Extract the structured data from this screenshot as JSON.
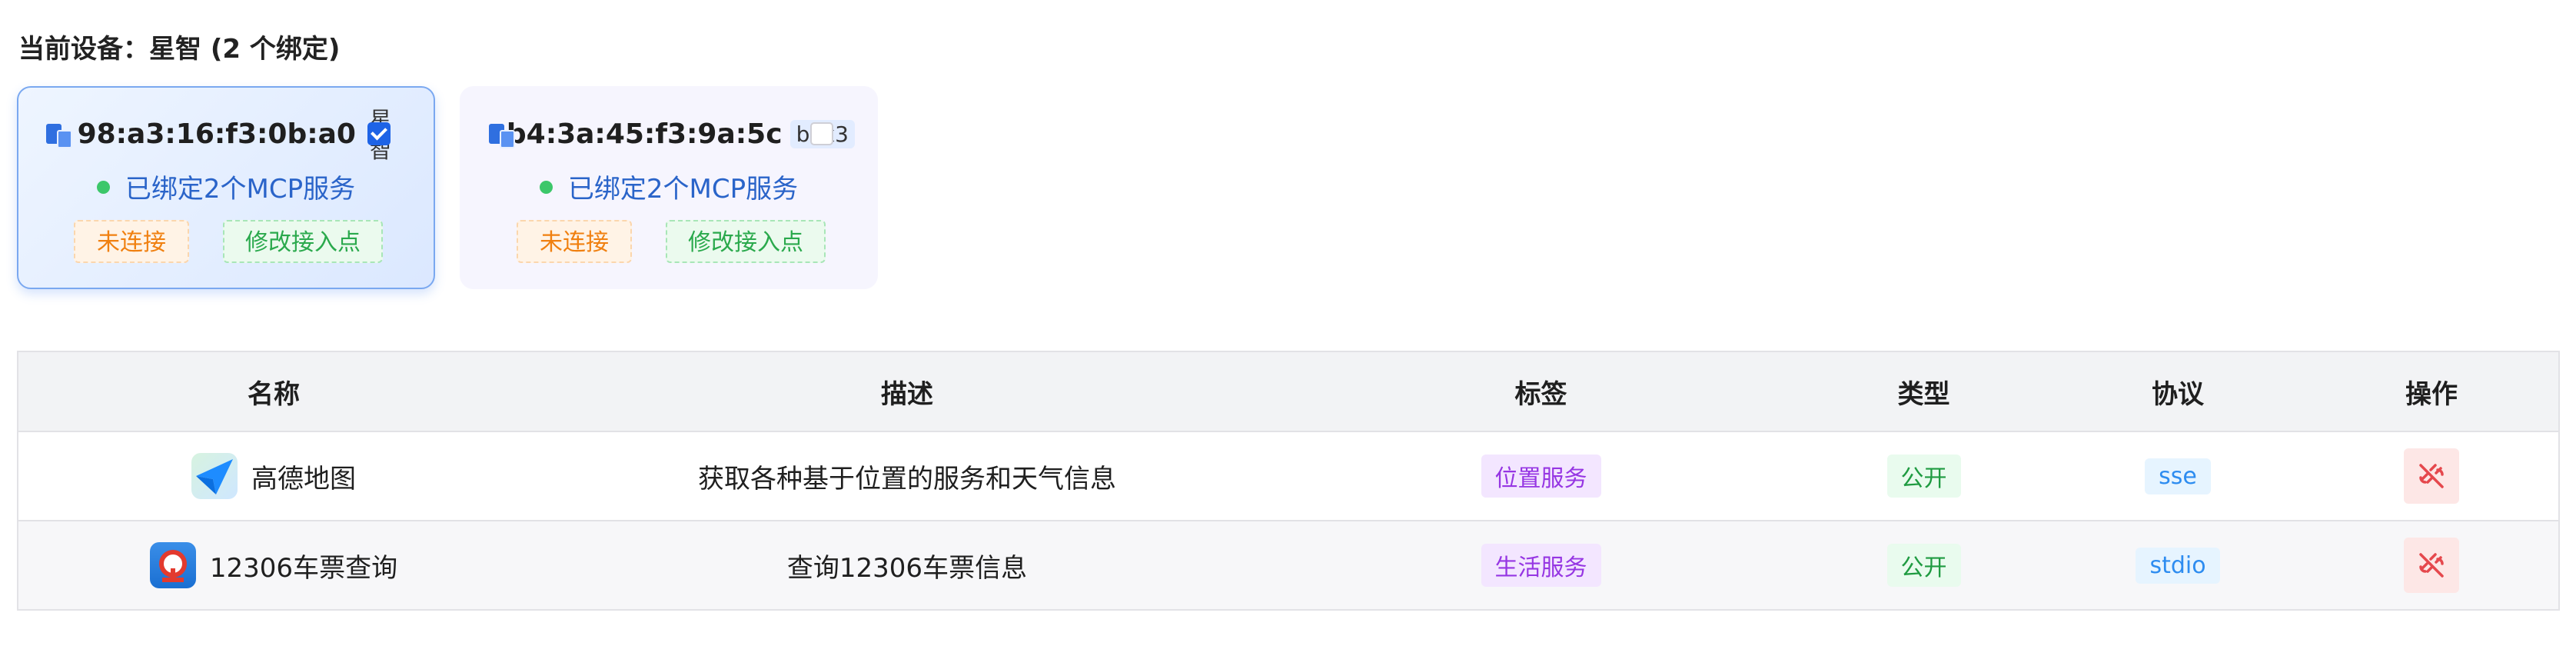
{
  "header": {
    "current_device": "当前设备：星智 (2 个绑定)"
  },
  "devices": [
    {
      "mac": "98:a3:16:f3:0b:a0",
      "alias": "星智",
      "checked": true,
      "bound_text": "已绑定2个MCP服务",
      "status": "未连接",
      "edit_label": "修改接入点"
    },
    {
      "mac": "b4:3a:45:f3:9a:5c",
      "alias": "box3",
      "checked": false,
      "bound_text": "已绑定2个MCP服务",
      "status": "未连接",
      "edit_label": "修改接入点"
    }
  ],
  "table": {
    "headers": [
      "名称",
      "描述",
      "标签",
      "类型",
      "协议",
      "操作"
    ],
    "rows": [
      {
        "name": "高德地图",
        "icon": "amap-icon",
        "description": "获取各种基于位置的服务和天气信息",
        "tag": "位置服务",
        "type": "公开",
        "protocol": "sse",
        "action_icon": "unlink-icon"
      },
      {
        "name": "12306车票查询",
        "icon": "railway-icon",
        "description": "查询12306车票信息",
        "tag": "生活服务",
        "type": "公开",
        "protocol": "stdio",
        "action_icon": "unlink-icon"
      }
    ]
  },
  "colors": {
    "accent": "#1e63e6",
    "online_dot": "#3cc76a",
    "warning": "#f08010",
    "success": "#2aa94c",
    "danger": "#e5484d"
  }
}
